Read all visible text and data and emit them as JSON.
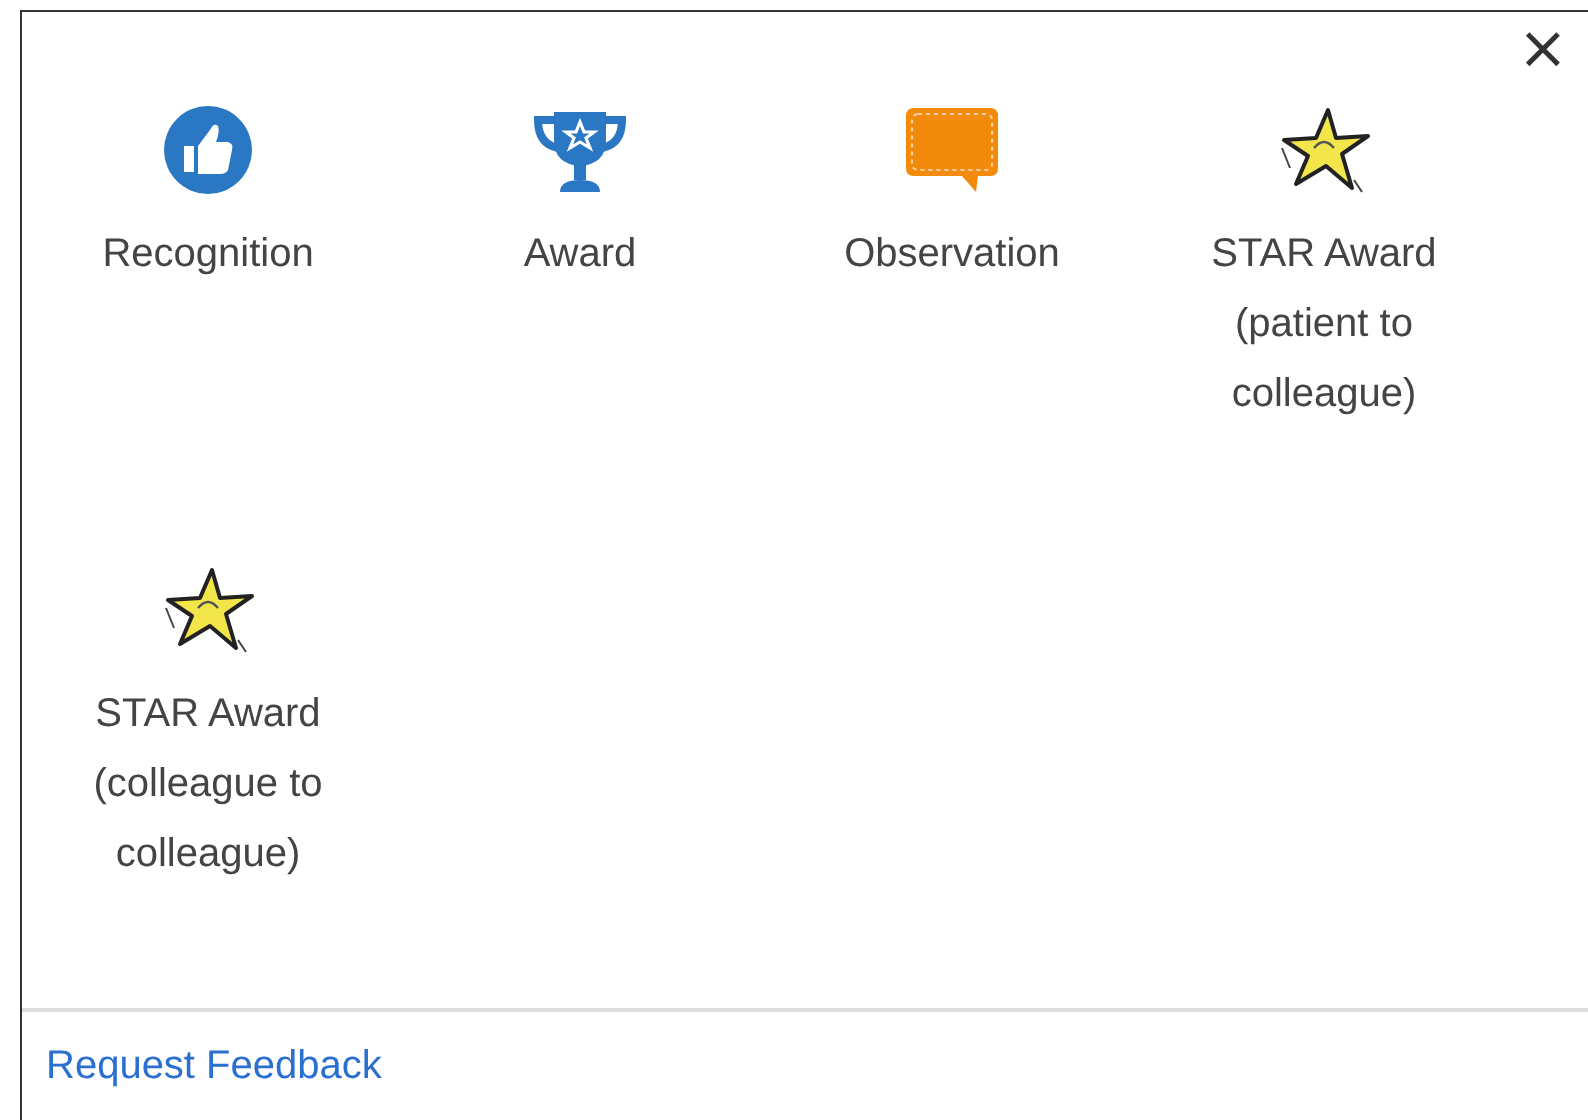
{
  "close_button": {
    "label": "×"
  },
  "options": [
    {
      "kind": "thumbs",
      "label": "Recognition"
    },
    {
      "kind": "trophy",
      "label": "Award"
    },
    {
      "kind": "speech",
      "label": "Observation"
    },
    {
      "kind": "star",
      "label": "STAR Award\n(patient to\ncolleague)"
    },
    {
      "kind": "star",
      "label": "STAR Award\n(colleague to\ncolleague)"
    }
  ],
  "footer": {
    "link": "Request Feedback"
  }
}
